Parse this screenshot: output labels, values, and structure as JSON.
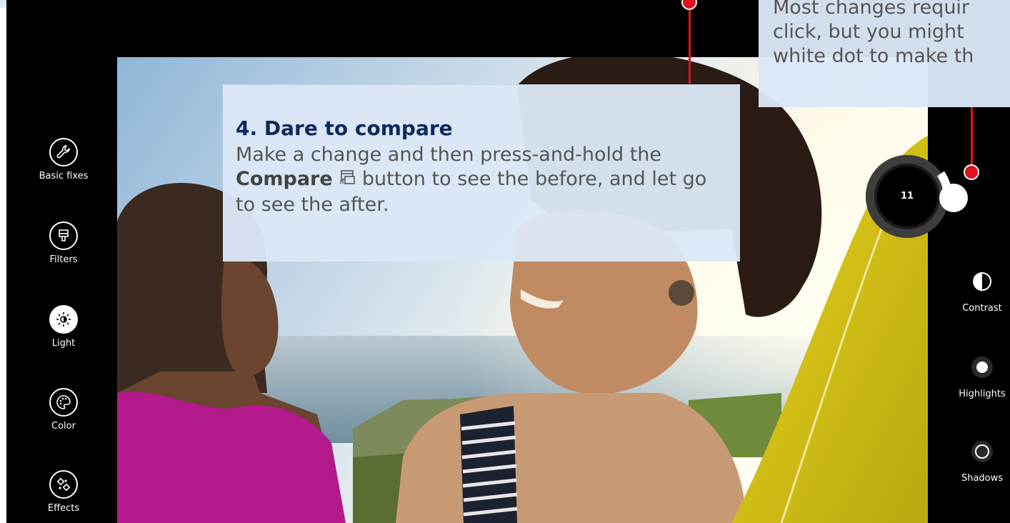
{
  "sidebar": {
    "items": [
      {
        "label": "Basic fixes",
        "icon": "wrench-icon",
        "active": false
      },
      {
        "label": "Filters",
        "icon": "brush-icon",
        "active": false
      },
      {
        "label": "Light",
        "icon": "sun-icon",
        "active": true
      },
      {
        "label": "Color",
        "icon": "palette-icon",
        "active": false
      },
      {
        "label": "Effects",
        "icon": "effects-icon",
        "active": false
      }
    ]
  },
  "adjustments": {
    "dial_value": "11",
    "items": [
      {
        "label": "Contrast",
        "icon": "contrast-icon"
      },
      {
        "label": "Highlights",
        "icon": "highlights-icon"
      },
      {
        "label": "Shadows",
        "icon": "shadows-icon"
      }
    ]
  },
  "callouts": {
    "compare": {
      "heading": "4. Dare to compare",
      "body_pre": "Make a change and then press-and-hold the ",
      "body_bold": "Compare",
      "body_post": " button to see the before, and let go to see the after."
    },
    "top_right": {
      "line1": "Most changes requir",
      "line2": "click, but you might",
      "line3": "white dot  to make th"
    }
  },
  "colors": {
    "accent_red": "#e0121b",
    "callout_bg": "#dce7f6",
    "heading_navy": "#0d2a5c"
  }
}
